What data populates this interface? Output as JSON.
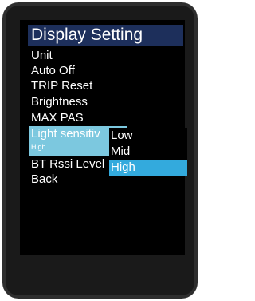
{
  "title": "Display Setting",
  "menu": {
    "items": [
      "Unit",
      "Auto Off",
      "TRIP Reset",
      "Brightness",
      "MAX PAS"
    ],
    "selected_label": "Light  sensitiv",
    "selected_value": "High",
    "after_items": [
      "BT Rssi Level",
      "Back"
    ]
  },
  "dropdown": {
    "options": [
      "Low",
      "Mid",
      "High"
    ],
    "selected": "High"
  },
  "colors": {
    "title_bg": "#1d2f5b",
    "selected_bg": "#7cc8df",
    "option_active_bg": "#33aadd"
  }
}
